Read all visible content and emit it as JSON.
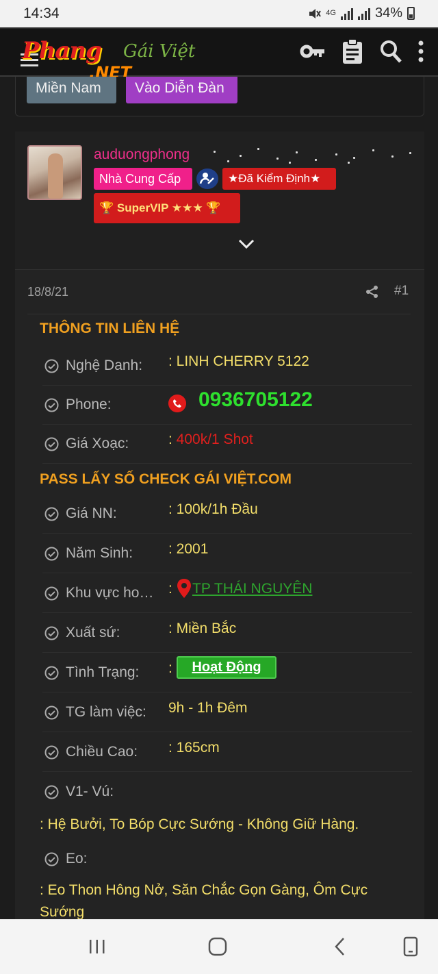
{
  "status_bar": {
    "time": "14:34",
    "network": "4G",
    "battery": "34%"
  },
  "header": {
    "logo_brand": "Phang",
    "logo_script": "Gái Việt",
    "logo_net": ".NET",
    "icons": [
      "key-icon",
      "clipboard-icon",
      "search-icon",
      "more-vertical-icon"
    ]
  },
  "top_buttons": {
    "mien_nam": "Miền Nam",
    "vao_dien_dan": "Vào Diễn Đàn"
  },
  "author": {
    "username": "auduongphong",
    "badge_provider": "Nhà Cung Cấp",
    "badge_verified": "★Đã Kiểm Định★",
    "badge_vip": "SuperVIP ★★★"
  },
  "post": {
    "date": "18/8/21",
    "number": "#1"
  },
  "contact": {
    "title": "THÔNG TIN LIÊN HỆ",
    "nghe_danh_label": "Nghệ Danh:",
    "nghe_danh_value": ": LINH CHERRY 5122",
    "phone_label": "Phone:",
    "phone_value": "0936705122",
    "gia_label": "Giá Xoạc:",
    "gia_prefix": ": ",
    "gia_value": "400k/1 Shot"
  },
  "pass": {
    "title": "PASS LẤY SỐ CHECK GÁI VIỆT.COM",
    "rows": [
      {
        "label": "Giá NN:",
        "value": ": 100k/1h Đầu"
      },
      {
        "label": "Năm Sinh:",
        "value": ": 2001"
      },
      {
        "label": "Khu vực hoạt động:",
        "value": ":",
        "link": "TP THÁI NGUYÊN"
      },
      {
        "label": "Xuất sứ:",
        "value": ": Miền Bắc"
      },
      {
        "label": "Tình Trạng:",
        "value": ":",
        "status": "Hoạt Động"
      },
      {
        "label": "TG làm việc:",
        "value": "9h - 1h Đêm"
      },
      {
        "label": "Chiều Cao:",
        "value": ": 165cm"
      },
      {
        "label": "V1- Vú:"
      }
    ],
    "v1_value": ": Hệ Bưởi, To Bóp Cực Sướng - Không Giữ Hàng.",
    "eo_label": "Eo:",
    "eo_value": ": Eo Thon Hông Nở, Săn Chắc Gọn Gàng, Ôm Cực Sướng"
  },
  "colors": {
    "accent_orange": "#f0a020",
    "phone_green": "#2ee02e",
    "status_green": "#26a826",
    "username_pink": "#ee2f8a"
  }
}
